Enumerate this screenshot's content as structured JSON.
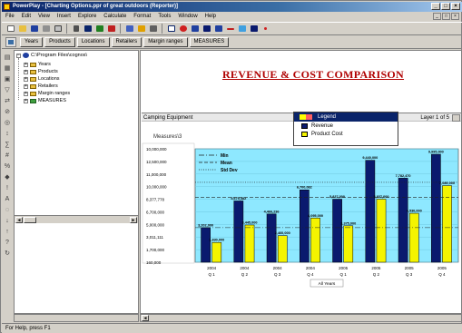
{
  "window": {
    "title": "PowerPlay - [Charting Options.ppr of great outdoors (Reporter)]",
    "controls": [
      "_",
      "□",
      "×"
    ],
    "mdi_controls": [
      "_",
      "□",
      "×"
    ]
  },
  "menu": [
    "File",
    "Edit",
    "View",
    "Insert",
    "Explore",
    "Calculate",
    "Format",
    "Tools",
    "Window",
    "Help"
  ],
  "dimension_line": [
    "Years",
    "Products",
    "Locations",
    "Retailers",
    "Margin ranges",
    "MEASURES"
  ],
  "tree": {
    "root": "C:\\Program Files\\cognos\\",
    "items": [
      "Years",
      "Products",
      "Locations",
      "Retailers",
      "Margin ranges",
      "MEASURES"
    ]
  },
  "report": {
    "title": "REVENUE & COST COMPARISON",
    "filter_left": "Camping Equipment",
    "filter_right": "Layer 1 of 5",
    "measure_label": "Measures\\3",
    "legend_title": "Legend",
    "x_axis_title": "All Years"
  },
  "chart_data": {
    "type": "bar",
    "categories": [
      "2004 Q 1",
      "2004 Q 2",
      "2004 Q 3",
      "2004 Q 4",
      "2005 Q 1",
      "2005 Q 2",
      "2005 Q 3",
      "2005 Q 4"
    ],
    "category_years": [
      "2004",
      "2004",
      "2004",
      "2004",
      "2005",
      "2005",
      "2005",
      "2005"
    ],
    "category_quarters": [
      "Q 1",
      "Q 2",
      "Q 3",
      "Q 4",
      "Q 1",
      "Q 2",
      "Q 3",
      "Q 4"
    ],
    "series": [
      {
        "name": "Revenue",
        "color": "#0a1a6e",
        "values": [
          3202000,
          5675482,
          4466236,
          6700082,
          5837000,
          9440000,
          7782470,
          9995000
        ],
        "labels": [
          "3,202,000",
          "5,675,482",
          "4,466,236",
          "6,700,082",
          "5,837,000",
          "9,440,000",
          "7,782,470",
          "9,995,000"
        ]
      },
      {
        "name": "Product Cost",
        "color": "#f4f400",
        "values": [
          1830000,
          3445000,
          2460000,
          4095000,
          3375000,
          5837000,
          4530000,
          7089000
        ],
        "labels": [
          "1,830,000",
          "3,445,000",
          "2,460,000",
          "4,095,000",
          "3,375,000",
          "5,837,000",
          "4,530,000",
          "7,089,000"
        ]
      }
    ],
    "reference_lines": [
      {
        "name": "Min",
        "value": 3202000,
        "style": "dash-dot"
      },
      {
        "name": "Mean",
        "value": 6000000,
        "style": "dashed"
      },
      {
        "name": "Std Dev",
        "value": 7400000,
        "style": "dotted"
      }
    ],
    "y_ticks": [
      "10,000,000",
      "12,500,000",
      "11,000,000",
      "10,000,000",
      "8,377,778",
      "6,700,000",
      "5,000,000",
      "3,011,111",
      "1,700,000",
      "160,000"
    ],
    "ylim": [
      0,
      10500000
    ],
    "background": "#8ee8ff",
    "grid": true,
    "legend": "top-center"
  },
  "status": "For Help, press F1"
}
